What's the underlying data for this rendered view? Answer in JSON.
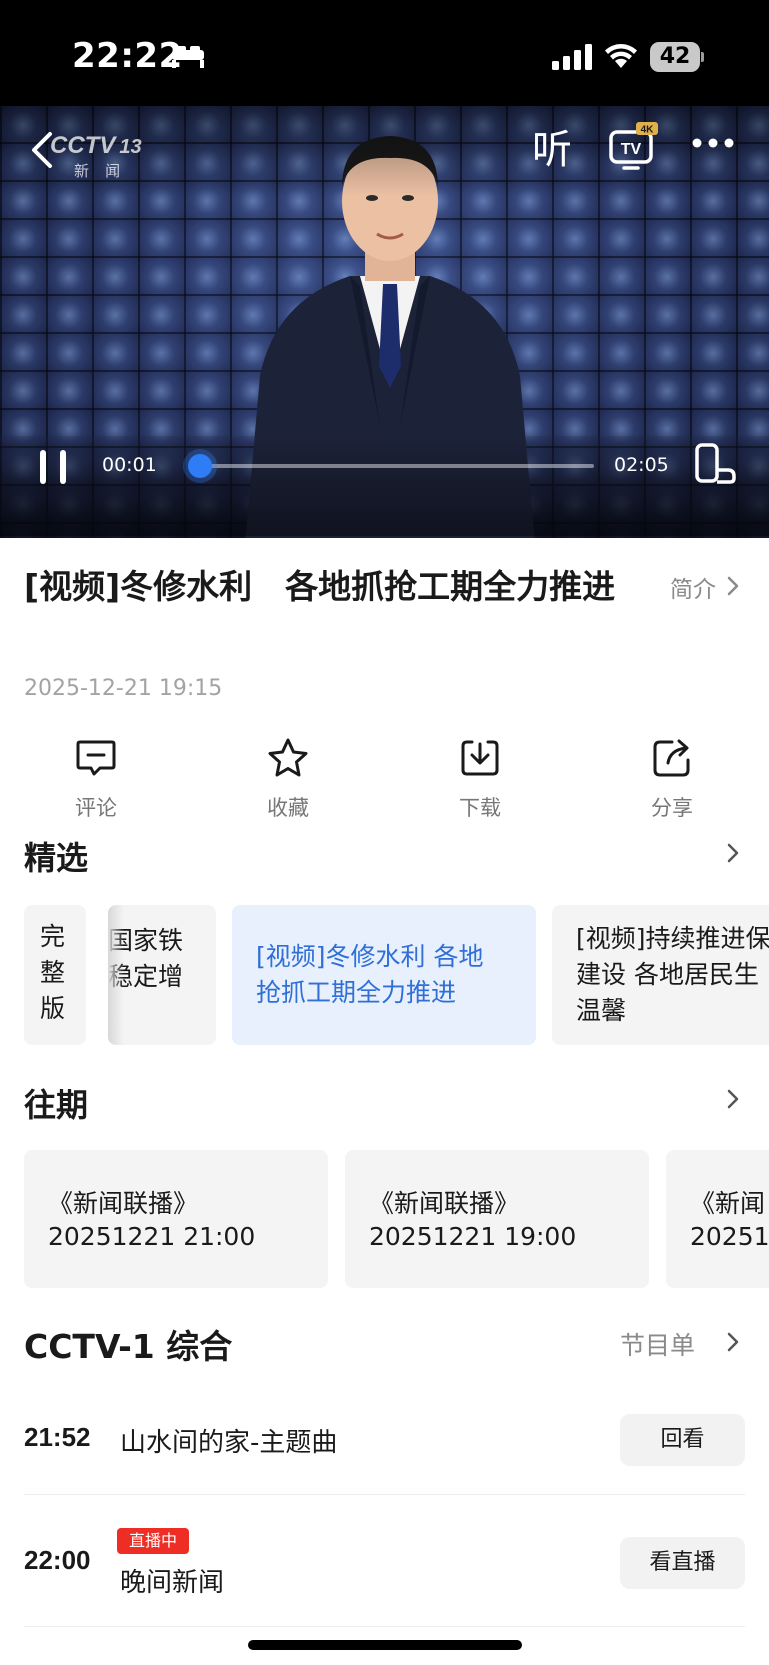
{
  "status_bar": {
    "time": "22:22",
    "battery": "42"
  },
  "player": {
    "channel_logo": "CCTV",
    "channel_number": "13",
    "channel_sub": "新 闻",
    "listen_label": "听",
    "tv_badge": "4K",
    "tv_label": "TV",
    "current_time": "00:01",
    "duration": "02:05",
    "progress": 0.01
  },
  "article": {
    "title": "[视频]冬修水利　各地抓抢工期全力推进",
    "intro_label": "简介",
    "date": "2025-12-21 19:15"
  },
  "actions": [
    {
      "label": "评论",
      "icon": "comment-icon"
    },
    {
      "label": "收藏",
      "icon": "star-icon"
    },
    {
      "label": "下载",
      "icon": "download-icon"
    },
    {
      "label": "分享",
      "icon": "share-icon"
    }
  ],
  "featured": {
    "title": "精选",
    "cards": [
      {
        "text": "完\n整\n版"
      },
      {
        "text": "国家铁\n稳定增"
      },
      {
        "text": "[视频]冬修水利 各地\n抢抓工期全力推进",
        "active": true
      },
      {
        "text": "[视频]持续推进保\n建设 各地居民生\n温馨"
      }
    ]
  },
  "past": {
    "title": "往期",
    "episodes": [
      {
        "name": "《新闻联播》",
        "time": "20251221 21:00"
      },
      {
        "name": "《新闻联播》",
        "time": "20251221 19:00"
      },
      {
        "name": "《新闻",
        "time": "20251"
      }
    ]
  },
  "schedule": {
    "channel": "CCTV-1 综合",
    "link_label": "节目单",
    "items": [
      {
        "time": "21:52",
        "name": "山水间的家-主题曲",
        "button": "回看"
      },
      {
        "time": "22:00",
        "name": "晚间新闻",
        "badge": "直播中",
        "button": "看直播"
      }
    ]
  },
  "colors": {
    "accent": "#2f7df6",
    "live": "#ee2e24",
    "card_bg": "#f4f4f4",
    "active_card_bg": "#e8f0fd"
  }
}
